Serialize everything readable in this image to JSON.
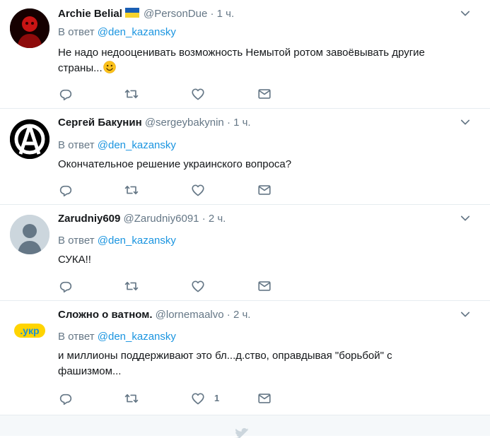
{
  "tweets": [
    {
      "name": "Archie Belial",
      "handle": "@PersonDue",
      "dot": "·",
      "time": "1 ч.",
      "reply_prefix": "В ответ",
      "reply_mention": "@den_kazansky",
      "text_line1": "Не надо недооценивать возможность Немытой ротом завоёвывать другие",
      "text_line2": "страны...",
      "flag_colors": [
        "#1a5fb4",
        "#f6d32d"
      ]
    },
    {
      "name": "Сергей Бакунин",
      "handle": "@sergeybakynin",
      "dot": "·",
      "time": "1 ч.",
      "reply_prefix": "В ответ",
      "reply_mention": "@den_kazansky",
      "text_line1": "Окончательное решение украинского вопроса?"
    },
    {
      "name": "Zarudniy609",
      "handle": "@Zarudniy6091",
      "dot": "·",
      "time": "2 ч.",
      "reply_prefix": "В ответ",
      "reply_mention": "@den_kazansky",
      "text_line1": "СУКА!!"
    },
    {
      "name": "Сложно о ватном.",
      "handle": "@lornemaalvo",
      "dot": "·",
      "time": "2 ч.",
      "reply_prefix": "В ответ",
      "reply_mention": "@den_kazansky",
      "text_line1": "и миллионы поддерживают это бл...д.ство, оправдывая \"борьбой\" с",
      "text_line2": "фашизмом...",
      "like_count": "1",
      "avatar_text": ".укр"
    }
  ],
  "icons": [
    "reply-icon",
    "retweet-icon",
    "like-icon",
    "direct-message-icon",
    "chevron-down-icon",
    "twitter-bird-icon"
  ],
  "colors": {
    "icon_gray": "#657786",
    "link_blue": "#1b95e0",
    "footer_bg": "#f5f8fa",
    "divider": "#e6ecf0"
  }
}
